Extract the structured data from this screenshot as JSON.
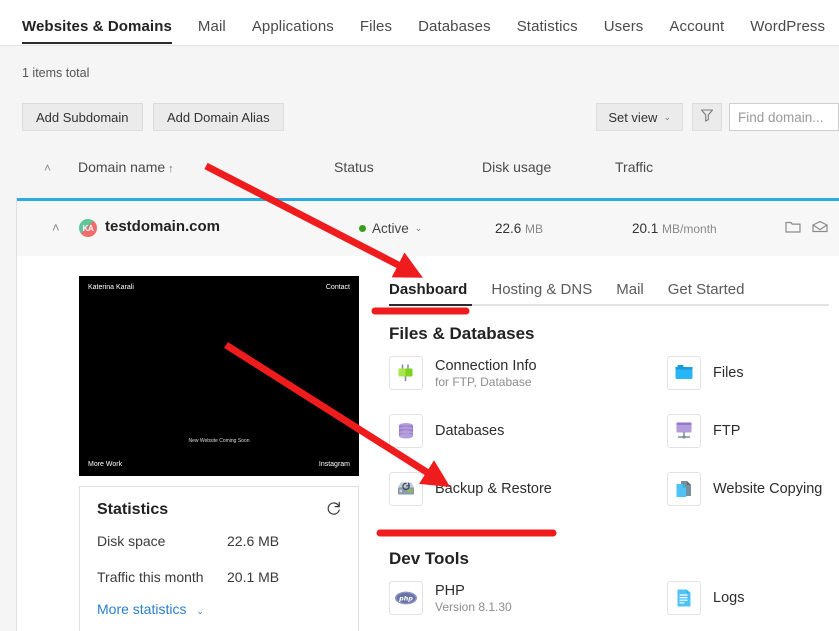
{
  "topnav": {
    "items": [
      {
        "label": "Websites & Domains",
        "active": true
      },
      {
        "label": "Mail",
        "active": false
      },
      {
        "label": "Applications",
        "active": false
      },
      {
        "label": "Files",
        "active": false
      },
      {
        "label": "Databases",
        "active": false
      },
      {
        "label": "Statistics",
        "active": false
      },
      {
        "label": "Users",
        "active": false
      },
      {
        "label": "Account",
        "active": false
      },
      {
        "label": "WordPress",
        "active": false
      }
    ],
    "more_label": "…"
  },
  "toolbar": {
    "items_total": "1 items total",
    "add_subdomain": "Add Subdomain",
    "add_domain_alias": "Add Domain Alias",
    "set_view": "Set view",
    "set_view_caret": "⌄",
    "filter_icon": "filter-icon",
    "search_placeholder": "Find domain..."
  },
  "list_header": {
    "collapse_icon": "˄",
    "domain_name": "Domain name",
    "sort_arrow": "↑",
    "status": "Status",
    "disk_usage": "Disk usage",
    "traffic": "Traffic"
  },
  "domain": {
    "chevron": "˄",
    "favicon_initials": "KA",
    "name": "testdomain.com",
    "status": "Active",
    "status_caret": "⌄",
    "status_color": "#3a9e1d",
    "disk_usage_value": "22.6",
    "disk_usage_unit": "MB",
    "traffic_value": "20.1",
    "traffic_unit": "MB/month",
    "row_icons": [
      "folder-icon",
      "mail-icon",
      "list-icon"
    ]
  },
  "preview": {
    "top_left": "Katerina Karali",
    "top_right": "Contact",
    "bottom_left": "More Work",
    "bottom_right": "Instagram",
    "center": "New Website Coming Soon"
  },
  "statistics": {
    "title": "Statistics",
    "refresh_icon": "refresh-icon",
    "rows": [
      {
        "label": "Disk space",
        "value": "22.6 MB"
      },
      {
        "label": "Traffic this month",
        "value": "20.1 MB"
      }
    ],
    "more_link": "More statistics",
    "more_caret": "⌄"
  },
  "subtabs": [
    {
      "label": "Dashboard",
      "active": true
    },
    {
      "label": "Hosting & DNS",
      "active": false
    },
    {
      "label": "Mail",
      "active": false
    },
    {
      "label": "Get Started",
      "active": false
    }
  ],
  "sections": {
    "files_databases": {
      "title": "Files & Databases",
      "tiles": [
        {
          "label": "Connection Info",
          "sub": "for FTP, Database",
          "icon": "plug-icon"
        },
        {
          "label": "Files",
          "sub": "",
          "icon": "folder-icon"
        },
        {
          "label": "Databases",
          "sub": "",
          "icon": "database-icon"
        },
        {
          "label": "FTP",
          "sub": "",
          "icon": "ftp-icon"
        },
        {
          "label": "Backup & Restore",
          "sub": "",
          "icon": "backup-drive-icon"
        },
        {
          "label": "Website Copying",
          "sub": "",
          "icon": "copy-pages-icon"
        }
      ]
    },
    "dev_tools": {
      "title": "Dev Tools",
      "tiles": [
        {
          "label": "PHP",
          "sub": "Version 8.1.30",
          "icon": "php-icon"
        },
        {
          "label": "Logs",
          "sub": "",
          "icon": "logs-icon"
        }
      ]
    }
  },
  "annotations": {
    "accent_red": "#ee1c1c",
    "arrow_1": "points from table header to Dashboard tab",
    "arrow_2": "points from preview to Backup & Restore",
    "underline_1": "under Dashboard tab",
    "underline_2": "under Backup & Restore"
  }
}
